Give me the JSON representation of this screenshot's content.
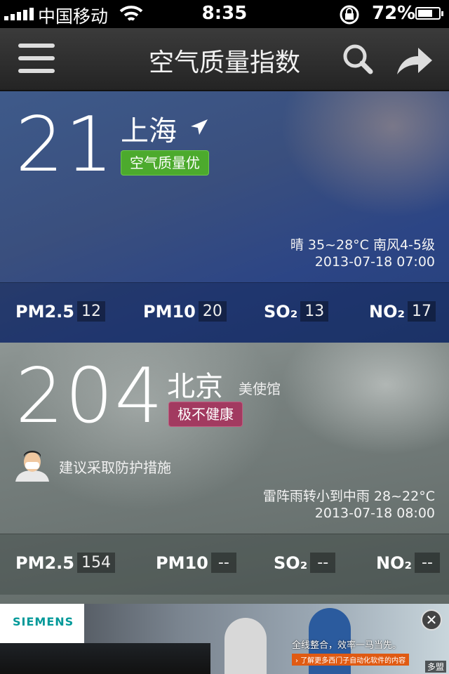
{
  "status_bar": {
    "carrier": "中国移动",
    "time": "8:35",
    "battery_percent": "72%",
    "battery_level": 0.72
  },
  "navbar": {
    "title": "空气质量指数",
    "menu_icon": "hamburger-menu-icon",
    "search_icon": "search-icon",
    "share_icon": "share-arrow-icon"
  },
  "cards": [
    {
      "aqi": "21",
      "city": "上海",
      "city_icon": "location-arrow-icon",
      "badge": "空气质量优",
      "badge_color": "#4caa2d",
      "weather": "晴 35~28°C 南风4-5级",
      "time": "2013-07-18 07:00",
      "pollutants": [
        {
          "name": "PM2.5",
          "value": "12"
        },
        {
          "name": "PM10",
          "value": "20"
        },
        {
          "name": "SO₂",
          "value": "13"
        },
        {
          "name": "NO₂",
          "value": "17"
        }
      ]
    },
    {
      "aqi": "204",
      "city": "北京",
      "station": "美使馆",
      "badge": "极不健康",
      "badge_color": "#a23a60",
      "advice": "建议采取防护措施",
      "advice_icon": "mask-person-icon",
      "weather": "雷阵雨转小到中雨 28~22°C",
      "time": "2013-07-18 08:00",
      "pollutants": [
        {
          "name": "PM2.5",
          "value": "154"
        },
        {
          "name": "PM10",
          "value": "--"
        },
        {
          "name": "SO₂",
          "value": "--"
        },
        {
          "name": "NO₂",
          "value": "--"
        }
      ]
    }
  ],
  "ad": {
    "logo": "SIEMENS",
    "slogan": "全线整合，效率一马当先。",
    "link": "了解更多西门子自动化软件的内容",
    "brand": "多盟",
    "close_icon": "close-icon"
  }
}
